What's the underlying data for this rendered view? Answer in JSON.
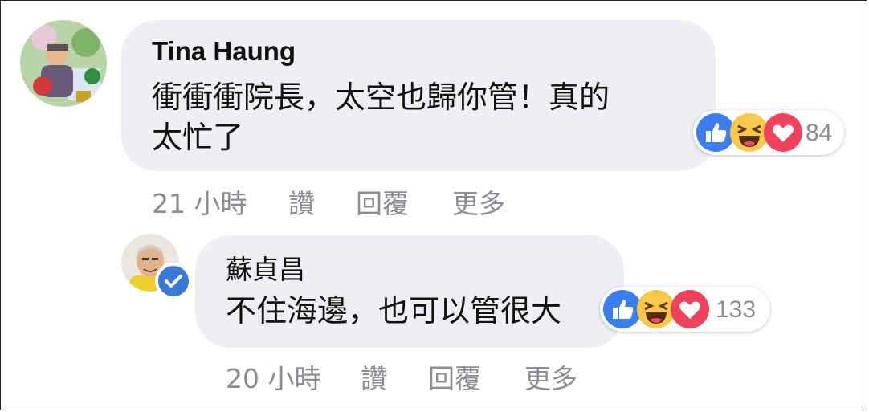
{
  "comments": [
    {
      "author": "Tina Haung",
      "text_line1": "衝衝衝院長，太空也歸你管！真的",
      "text_line2": "太忙了",
      "reaction_count": "84",
      "reactions": [
        "like-icon",
        "haha-icon",
        "love-icon"
      ],
      "time": "21 小時",
      "like_label": "讚",
      "reply_label": "回覆",
      "more_label": "更多"
    },
    {
      "author": "蘇貞昌",
      "verified": true,
      "text_line1": "不住海邊，也可以管很大",
      "reaction_count": "133",
      "reactions": [
        "like-icon",
        "haha-icon",
        "love-icon"
      ],
      "time": "20 小時",
      "like_label": "讚",
      "reply_label": "回覆",
      "more_label": "更多"
    }
  ],
  "colors": {
    "bubble": "#eeeff3",
    "like": "#3b7ef0",
    "haha": "#f7c84a",
    "love": "#f0425b",
    "meta_text": "#8a8d91",
    "verified": "#3a7ad6"
  }
}
